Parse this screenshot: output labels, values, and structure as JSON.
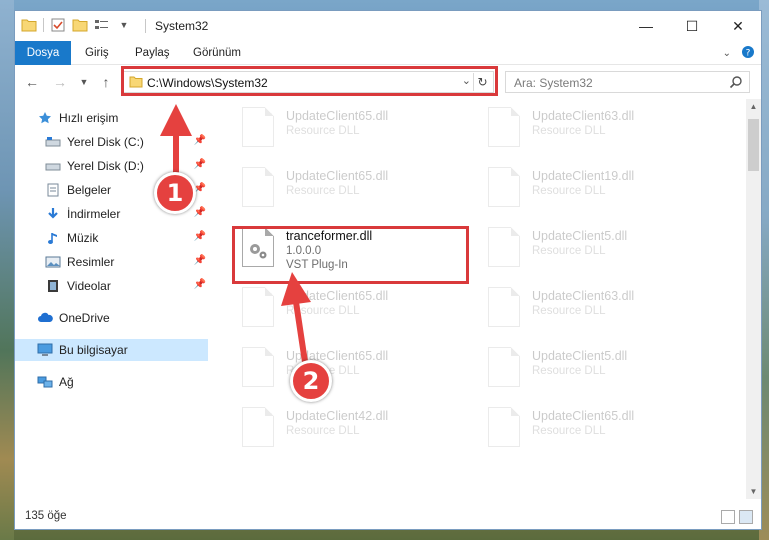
{
  "window": {
    "title": "System32"
  },
  "controls": {
    "minimize": "—",
    "maximize": "☐",
    "close": "✕"
  },
  "ribbon": {
    "tabs": [
      "Dosya",
      "Giriş",
      "Paylaş",
      "Görünüm"
    ]
  },
  "address": {
    "path": "C:\\Windows\\System32"
  },
  "search": {
    "placeholder": "Ara: System32"
  },
  "sidebar": {
    "items": [
      {
        "label": "Hızlı erişim",
        "icon": "star-icon",
        "pinned": false
      },
      {
        "label": "Yerel Disk (C:)",
        "icon": "drive-icon",
        "pinned": true
      },
      {
        "label": "Yerel Disk (D:)",
        "icon": "drive-icon",
        "pinned": true
      },
      {
        "label": "Belgeler",
        "icon": "documents-icon",
        "pinned": true
      },
      {
        "label": "İndirmeler",
        "icon": "downloads-icon",
        "pinned": true
      },
      {
        "label": "Müzik",
        "icon": "music-icon",
        "pinned": true
      },
      {
        "label": "Resimler",
        "icon": "pictures-icon",
        "pinned": true
      },
      {
        "label": "Videolar",
        "icon": "videos-icon",
        "pinned": true
      },
      {
        "label": "OneDrive",
        "icon": "cloud-icon",
        "pinned": false
      },
      {
        "label": "Bu bilgisayar",
        "icon": "computer-icon",
        "pinned": false,
        "selected": true
      },
      {
        "label": "Ağ",
        "icon": "network-icon",
        "pinned": false
      }
    ]
  },
  "files": [
    {
      "name": "UpdateClient65.dll",
      "type": "Resource DLL"
    },
    {
      "name": "UpdateClient63.dll",
      "type": "Resource DLL"
    },
    {
      "name": "UpdateClient65.dll",
      "type": "Resource DLL"
    },
    {
      "name": "UpdateClient19.dll",
      "type": "Resource DLL"
    },
    {
      "name": "tranceformer.dll",
      "version": "1.0.0.0",
      "type": "VST Plug-In",
      "highlighted": true
    },
    {
      "name": "UpdateClient5.dll",
      "type": "Resource DLL"
    },
    {
      "name": "UpdateClient65.dll",
      "type": "Resource DLL"
    },
    {
      "name": "UpdateClient63.dll",
      "type": "Resource DLL"
    },
    {
      "name": "UpdateClient65.dll",
      "type": "Resource DLL"
    },
    {
      "name": "UpdateClient5.dll",
      "type": "Resource DLL"
    },
    {
      "name": "UpdateClient42.dll",
      "type": "Resource DLL"
    },
    {
      "name": "UpdateClient65.dll",
      "type": "Resource DLL"
    }
  ],
  "status": {
    "count": "135 öğe"
  },
  "annotations": {
    "badge1": "1",
    "badge2": "2",
    "color": "#d9393b"
  }
}
